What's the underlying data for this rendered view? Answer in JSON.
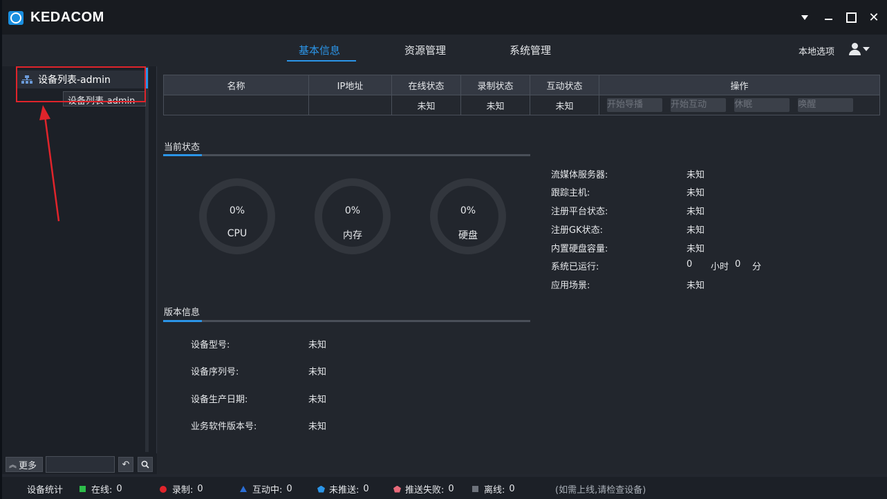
{
  "titlebar": {
    "brand": "KEDACOM"
  },
  "nav": {
    "tabs": [
      {
        "label": "基本信息",
        "active": true
      },
      {
        "label": "资源管理",
        "active": false
      },
      {
        "label": "系统管理",
        "active": false
      }
    ],
    "local_options": "本地选项"
  },
  "sidebar": {
    "tree_item": "设备列表-admin",
    "tooltip": "设备列表-admin",
    "more_label": "更多",
    "search_value": ""
  },
  "table": {
    "headers": [
      "名称",
      "IP地址",
      "在线状态",
      "录制状态",
      "互动状态",
      "操作"
    ],
    "row": {
      "name": "",
      "ip": "",
      "online": "未知",
      "recording": "未知",
      "interaction": "未知"
    },
    "actions": [
      "开始导播",
      "开始互动",
      "休眠",
      "唤醒"
    ]
  },
  "current_status": {
    "title": "当前状态",
    "gauges": [
      {
        "value": "0%",
        "label": "CPU"
      },
      {
        "value": "0%",
        "label": "内存"
      },
      {
        "value": "0%",
        "label": "硬盘"
      }
    ],
    "info": [
      {
        "label": "流媒体服务器:",
        "value": "未知"
      },
      {
        "label": "跟踪主机:",
        "value": "未知"
      },
      {
        "label": "注册平台状态:",
        "value": "未知"
      },
      {
        "label": "注册GK状态:",
        "value": "未知"
      },
      {
        "label": "内置硬盘容量:",
        "value": "未知"
      },
      {
        "label": "系统已运行:",
        "value": ""
      },
      {
        "label": "应用场景:",
        "value": "未知"
      }
    ],
    "uptime": {
      "hours": "0",
      "hours_unit": "小时",
      "minutes": "0",
      "minutes_unit": "分"
    }
  },
  "version_info": {
    "title": "版本信息",
    "items": [
      {
        "label": "设备型号:",
        "value": "未知"
      },
      {
        "label": "设备序列号:",
        "value": "未知"
      },
      {
        "label": "设备生产日期:",
        "value": "未知"
      },
      {
        "label": "业务软件版本号:",
        "value": "未知"
      }
    ]
  },
  "statusbar": {
    "title": "设备统计",
    "items": [
      {
        "label": "在线:",
        "count": "0",
        "color": "#2dbd4a"
      },
      {
        "label": "录制:",
        "count": "0",
        "color": "#e0242b"
      },
      {
        "label": "互动中:",
        "count": "0",
        "color": "#2b6ed6"
      },
      {
        "label": "未推送:",
        "count": "0",
        "color": "#2b95e8"
      },
      {
        "label": "推送失败:",
        "count": "0",
        "color": "#e86a7a"
      },
      {
        "label": "离线:",
        "count": "0",
        "color": "#6e737c"
      }
    ],
    "hint": "(如需上线,请检查设备)"
  },
  "colors": {
    "accent": "#2b95e8",
    "annotation": "#e0242b"
  },
  "icons": [
    "logo-icon",
    "menu-caret-icon",
    "minimize-icon",
    "maximize-icon",
    "close-icon",
    "user-icon",
    "device-tree-icon",
    "chevron-up-icon",
    "undo-icon",
    "search-icon"
  ]
}
